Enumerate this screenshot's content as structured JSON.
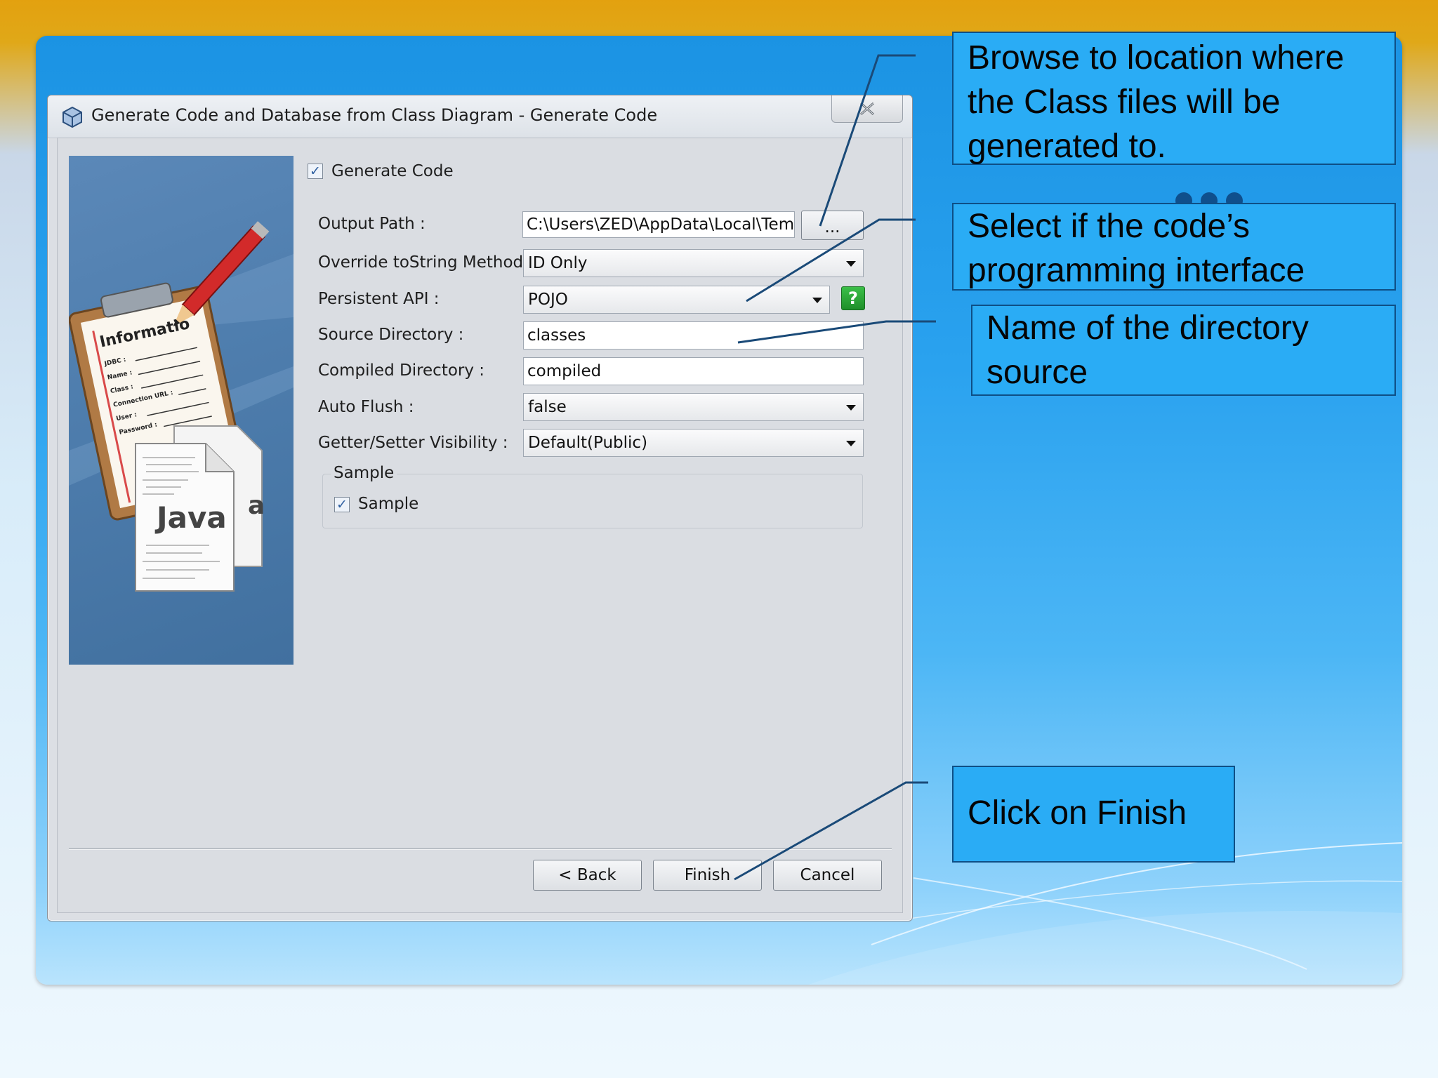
{
  "dialog": {
    "title": "Generate Code and Database from Class Diagram - Generate Code",
    "close_icon": "close-icon"
  },
  "image": {
    "header_text": "Informatio",
    "doc_text": "Java",
    "partial_text": "a",
    "form_lines": [
      "JDBC :",
      "Name :",
      "Class :",
      "Connection URL :",
      "User :",
      "Password :"
    ]
  },
  "form": {
    "generate_code": {
      "label": "Generate Code",
      "checked": true
    },
    "output_path": {
      "label": "Output Path :",
      "value": "C:\\Users\\ZED\\AppData\\Local\\Temp\\",
      "browse_label": "..."
    },
    "override_tostring": {
      "label": "Override toString Method :",
      "value": "ID Only"
    },
    "persistent_api": {
      "label": "Persistent API :",
      "value": "POJO",
      "help_label": "?"
    },
    "source_directory": {
      "label": "Source Directory :",
      "value": "classes"
    },
    "compiled_directory": {
      "label": "Compiled Directory :",
      "value": "compiled"
    },
    "auto_flush": {
      "label": "Auto Flush :",
      "value": "false"
    },
    "getter_setter": {
      "label": "Getter/Setter Visibility :",
      "value": "Default(Public)"
    },
    "sample_group": {
      "title": "Sample",
      "checkbox_label": "Sample",
      "checked": true
    }
  },
  "buttons": {
    "back": "< Back",
    "finish": "Finish",
    "cancel": "Cancel"
  },
  "callouts": {
    "browse": [
      "Browse to location where",
      "the Class files will be",
      "generated to."
    ],
    "select_api": [
      "Select if the code’s",
      "programming interface"
    ],
    "directory": [
      "Name of the directory",
      "source"
    ],
    "finish": [
      "Click on Finish"
    ]
  },
  "colors": {
    "slide_blue": "#2aacf5",
    "callout_border": "#0e4f86",
    "leader_line": "#1a4a78",
    "top_bar": "#e3a10f"
  }
}
